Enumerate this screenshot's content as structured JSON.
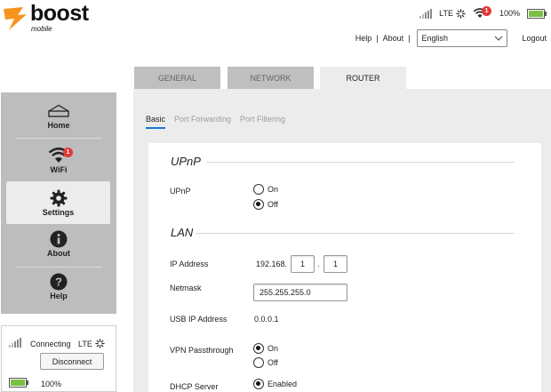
{
  "brand": {
    "name": "boost",
    "sub": "mobile",
    "color": "#f7941d"
  },
  "status": {
    "network": "LTE",
    "wifi_clients": "1",
    "battery": "100%"
  },
  "toplinks": {
    "help": "Help",
    "about": "About",
    "language": "English",
    "logout": "Logout"
  },
  "tabs": [
    {
      "label": "GENERAL"
    },
    {
      "label": "NETWORK"
    },
    {
      "label": "ROUTER"
    }
  ],
  "active_tab": "ROUTER",
  "sidebar": {
    "items": [
      {
        "label": "Home",
        "icon": "home-icon"
      },
      {
        "label": "WiFi",
        "icon": "wifi-icon",
        "badge": "1"
      },
      {
        "label": "Settings",
        "icon": "gear-icon"
      },
      {
        "label": "About",
        "icon": "info-icon"
      },
      {
        "label": "Help",
        "icon": "question-icon"
      }
    ],
    "active": "Settings"
  },
  "connection": {
    "status": "Connecting",
    "network": "LTE",
    "button": "Disconnect",
    "battery": "100%"
  },
  "subtabs": [
    {
      "label": "Basic"
    },
    {
      "label": "Port Forwarding"
    },
    {
      "label": "Port Filtering"
    }
  ],
  "router": {
    "upnp": {
      "section": "UPnP",
      "label": "UPnP",
      "options": [
        "On",
        "Off"
      ],
      "selected": "Off"
    },
    "lan": {
      "section": "LAN",
      "ip_label": "IP Address",
      "ip_prefix": "192.168.",
      "ip_octet3": "1",
      "ip_dot": ".",
      "ip_octet4": "1",
      "netmask_label": "Netmask",
      "netmask": "255.255.255.0",
      "usb_label": "USB IP Address",
      "usb_ip": "0.0.0.1",
      "vpn_label": "VPN Passthrough",
      "vpn_options": [
        "On",
        "Off"
      ],
      "vpn_selected": "On",
      "dhcp_label": "DHCP Server",
      "dhcp_option": "Enabled"
    }
  }
}
